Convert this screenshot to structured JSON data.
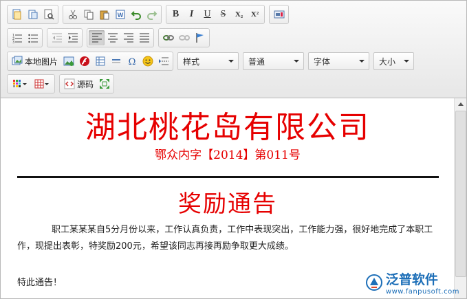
{
  "toolbar": {
    "source_label": "源码",
    "image_label": "本地图片",
    "style_select": "样式",
    "format_select": "普通",
    "font_select": "字体",
    "size_select": "大小",
    "bold": "B",
    "italic": "I",
    "underline": "U",
    "strike": "S",
    "sub": "X₂",
    "sup": "X²"
  },
  "document": {
    "company_title": "湖北桃花岛有限公司",
    "doc_number": "鄂众内字【2014】第011号",
    "notice_title": "奖励通告",
    "body_text": "职工某某某自5分月份以来，工作认真负责，工作中表现突出，工作能力强，很好地完成了本职工作，现提出表彰，特奖励200元，希望该同志再接再励争取更大成绩。",
    "closing": "特此通告！"
  },
  "watermark": {
    "name": "泛普软件",
    "url": "www.fanpusoft.com"
  },
  "colors": {
    "heading_red": "#e60000",
    "brand_blue": "#1d6fb8"
  }
}
